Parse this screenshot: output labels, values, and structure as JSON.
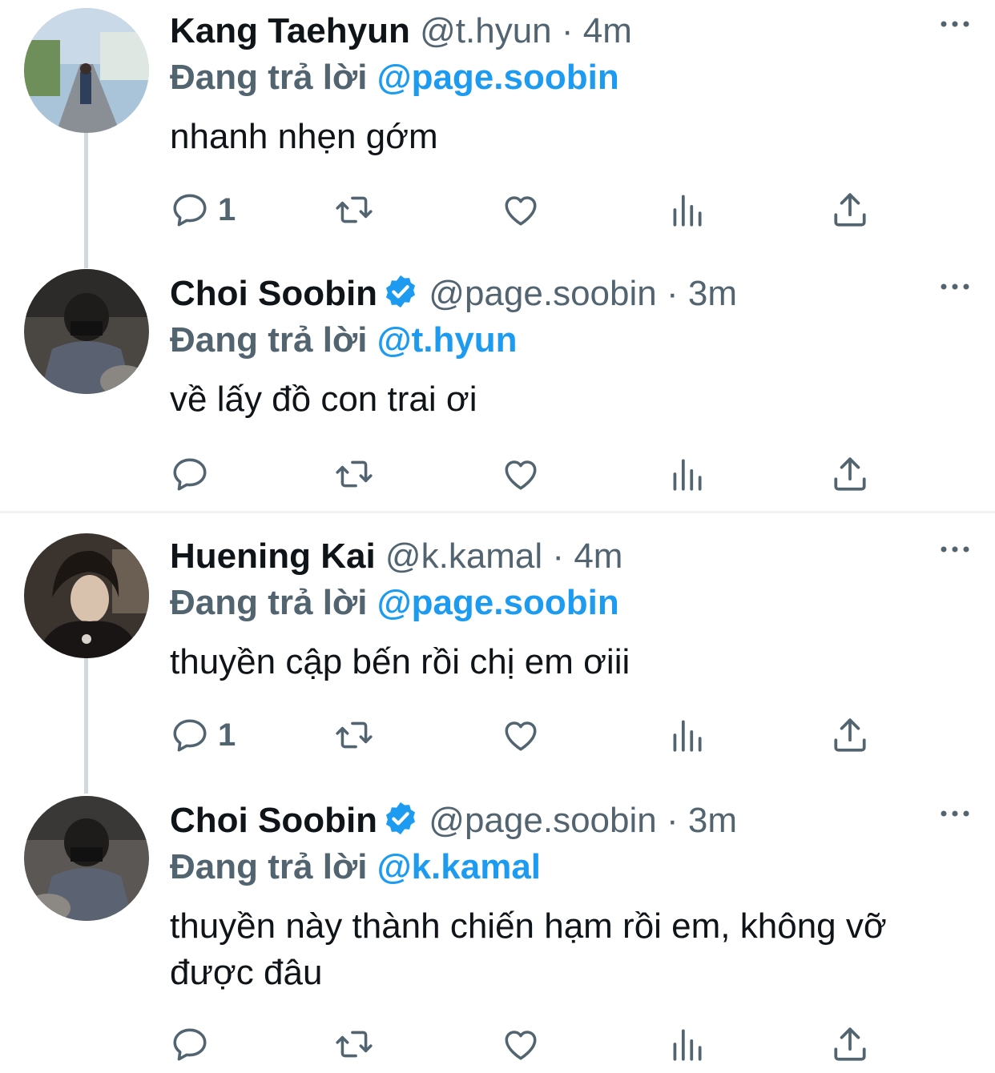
{
  "tweets": [
    {
      "name": "Kang Taehyun",
      "handle": "@t.hyun",
      "separator": "·",
      "time": "4m",
      "replying_prefix": "Đang trả lời",
      "replying_to": "@page.soobin",
      "text": "nhanh nhẹn gớm",
      "reply_count": "1",
      "verified": false
    },
    {
      "name": "Choi Soobin",
      "handle": "@page.soobin",
      "separator": "·",
      "time": "3m",
      "replying_prefix": "Đang trả lời",
      "replying_to": "@t.hyun",
      "text": "về lấy đồ con trai ơi",
      "reply_count": "",
      "verified": true
    },
    {
      "name": "Huening Kai",
      "handle": "@k.kamal",
      "separator": "·",
      "time": "4m",
      "replying_prefix": "Đang trả lời",
      "replying_to": "@page.soobin",
      "text": "thuyền cập bến rồi chị em ơiii",
      "reply_count": "1",
      "verified": false
    },
    {
      "name": "Choi Soobin",
      "handle": "@page.soobin",
      "separator": "·",
      "time": "3m",
      "replying_prefix": "Đang trả lời",
      "replying_to": "@k.kamal",
      "text": "thuyền này thành chiến hạm rồi em, không vỡ được đâu",
      "reply_count": "",
      "verified": true
    }
  ],
  "colors": {
    "text": "#0f1419",
    "secondary": "#536471",
    "accent": "#1d9bf0",
    "thread_line": "#cfd9de"
  },
  "icons": [
    "reply-icon",
    "retweet-icon",
    "like-icon",
    "views-icon",
    "share-icon",
    "more-icon",
    "verified-icon"
  ]
}
